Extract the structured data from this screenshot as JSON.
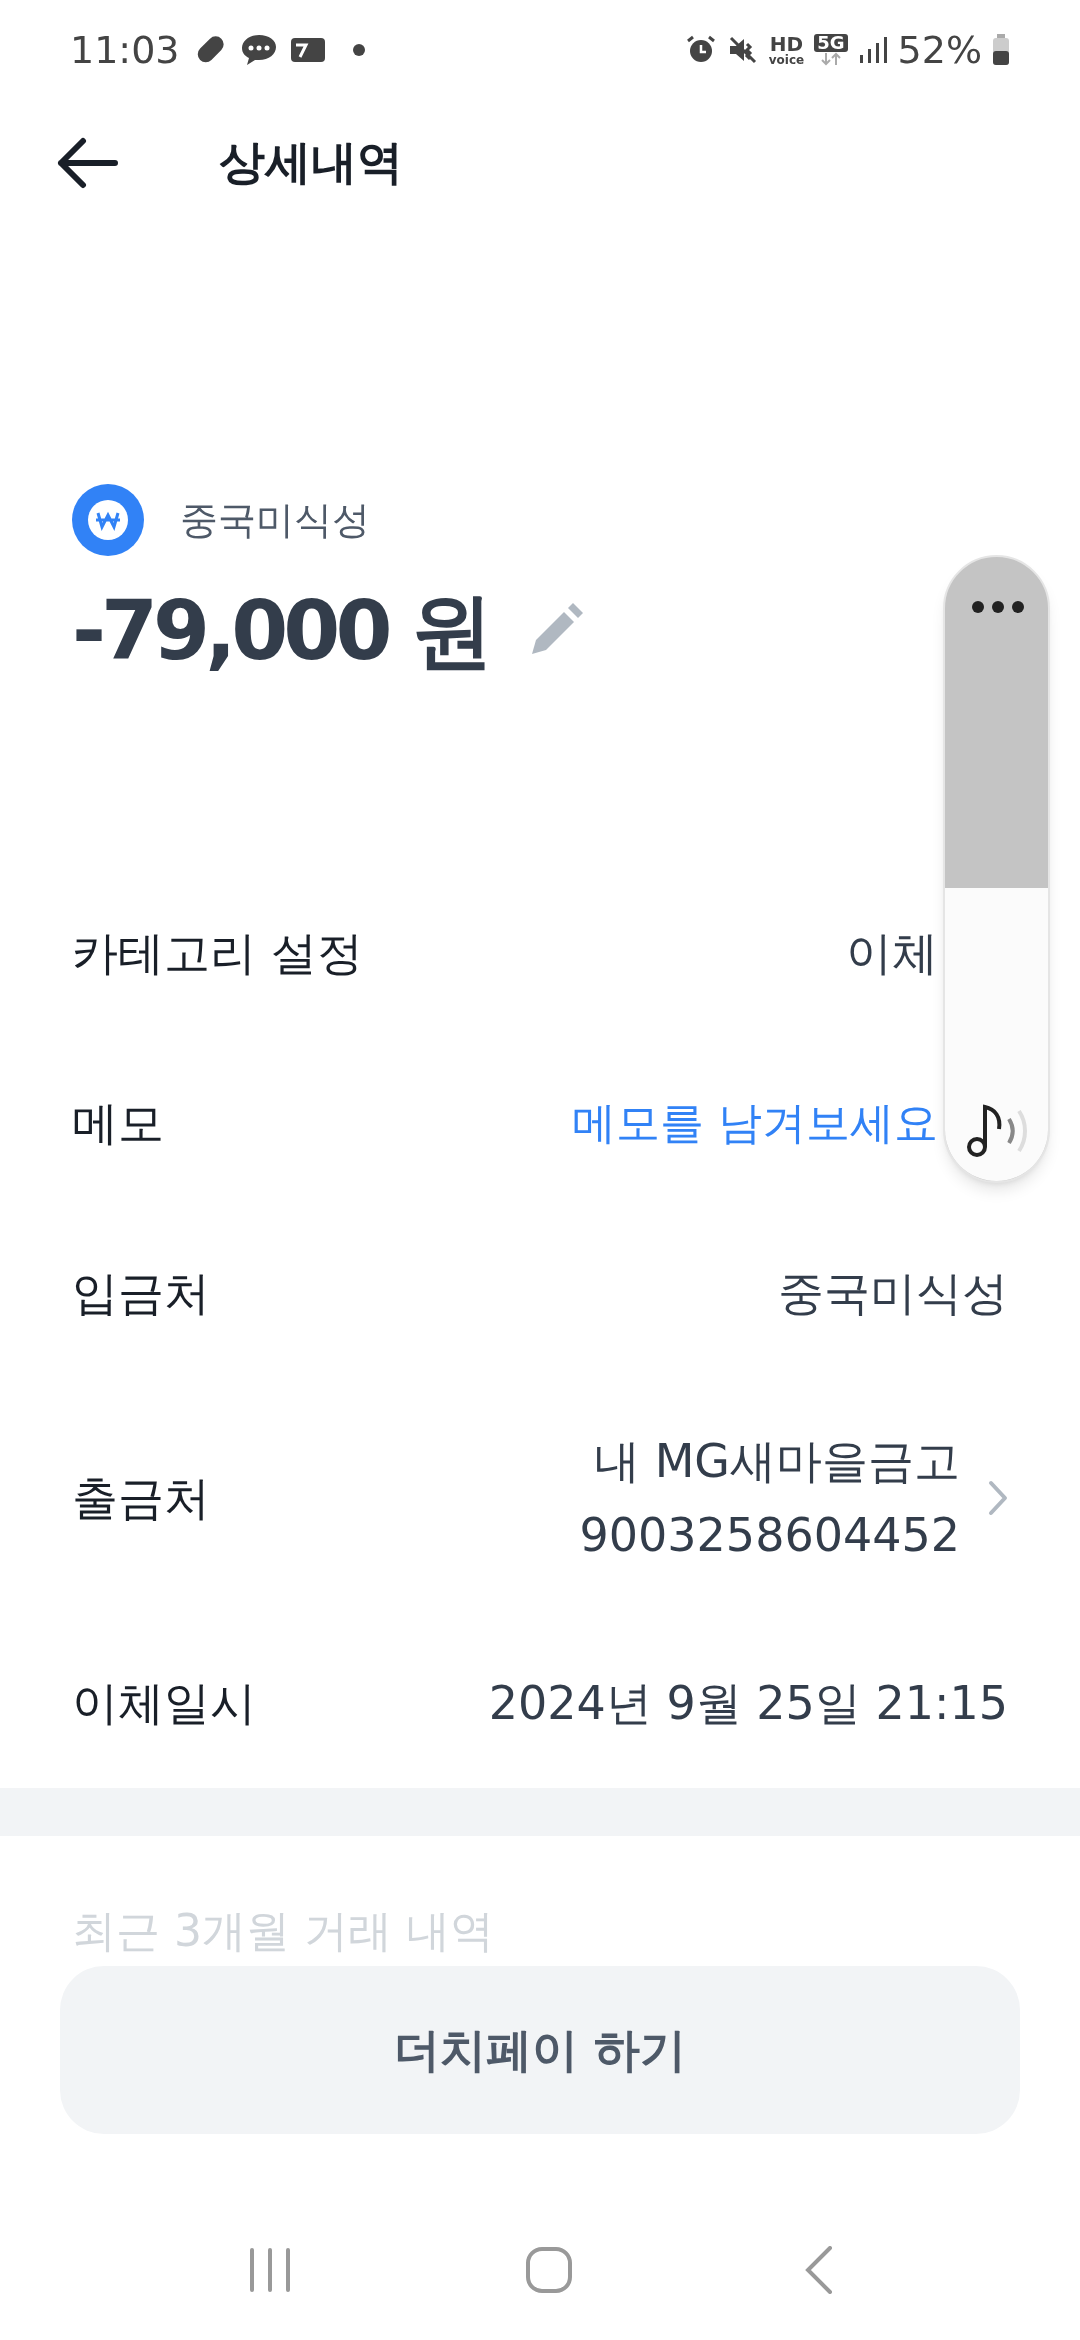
{
  "status_bar": {
    "time": "11:03",
    "hd": "HD",
    "voice": "voice",
    "network": "5G",
    "battery": "52%"
  },
  "header": {
    "title": "상세내역"
  },
  "transaction": {
    "merchant": "중국미식성",
    "amount": "-79,000 원"
  },
  "details": [
    {
      "kind": "text",
      "label": "카테고리 설정",
      "value": "이체"
    },
    {
      "kind": "link",
      "label": "메모",
      "value": "메모를 남겨보세요"
    },
    {
      "kind": "text",
      "label": "입금처",
      "value": "중국미식성"
    },
    {
      "kind": "account",
      "label": "출금처",
      "value": "내 MG새마을금고",
      "sub": "9003258604452"
    },
    {
      "kind": "text",
      "label": "이체일시",
      "value": "2024년 9월 25일 21:15"
    }
  ],
  "recent": {
    "title": "최근 3개월 거래 내역"
  },
  "action_button": "더치페이 하기",
  "volume": {
    "level": 0.47
  }
}
